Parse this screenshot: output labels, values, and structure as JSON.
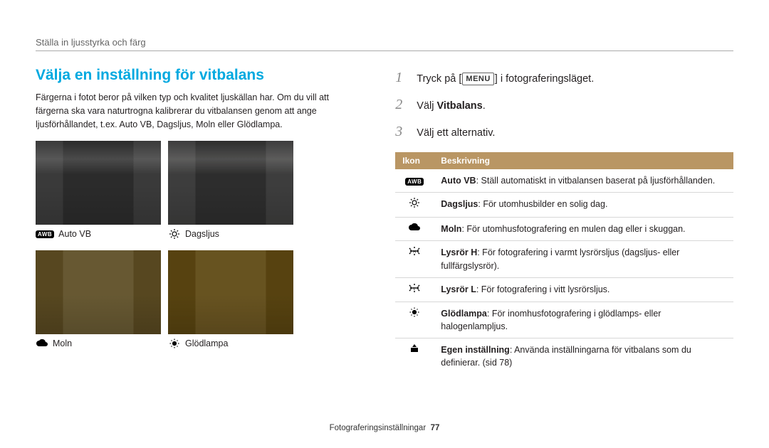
{
  "breadcrumb": "Ställa in ljusstyrka och färg",
  "left": {
    "heading": "Välja en inställning för vitbalans",
    "intro": "Färgerna i fotot beror på vilken typ och kvalitet ljuskällan har. Om du vill att färgerna ska vara naturtrogna kalibrerar du vitbalansen genom att ange ljusförhållandet, t.ex. Auto VB, Dagsljus, Moln eller Glödlampa.",
    "thumbs": {
      "autovb": "Auto VB",
      "daylight": "Dagsljus",
      "cloud": "Moln",
      "tungsten": "Glödlampa"
    }
  },
  "right": {
    "steps": {
      "s1a": "Tryck på [",
      "menu": "MENU",
      "s1b": "] i fotograferingsläget.",
      "s2a": "Välj ",
      "s2b": "Vitbalans",
      "s2c": ".",
      "s3": "Välj ett alternativ."
    },
    "table": {
      "head_icon": "Ikon",
      "head_desc": "Beskrivning",
      "rows": [
        {
          "icon": "awb",
          "bold": "Auto VB",
          "rest": ": Ställ automatiskt in vitbalansen baserat på ljusförhållanden."
        },
        {
          "icon": "sun",
          "bold": "Dagsljus",
          "rest": ": För utomhusbilder en solig dag."
        },
        {
          "icon": "cloud",
          "bold": "Moln",
          "rest": ": För utomhusfotografering en mulen dag eller i skuggan."
        },
        {
          "icon": "flH",
          "bold": "Lysrör H",
          "rest": ": För fotografering i varmt lysrörsljus (dagsljus- eller fullfärgslysrör)."
        },
        {
          "icon": "flL",
          "bold": "Lysrör L",
          "rest": ": För fotografering i vitt lysrörsljus."
        },
        {
          "icon": "bulb",
          "bold": "Glödlampa",
          "rest": ": För inomhusfotografering i glödlamps- eller halogenlampljus."
        },
        {
          "icon": "custom",
          "bold": "Egen inställning",
          "rest": ": Använda inställningarna för vitbalans som du definierar. (sid 78)"
        }
      ]
    }
  },
  "footer": {
    "label": "Fotograferingsinställningar",
    "page": "77"
  }
}
